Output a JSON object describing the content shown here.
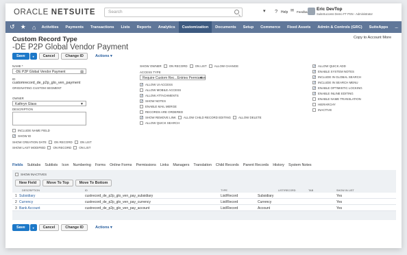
{
  "brand": {
    "oracle": "ORACLE",
    "netsuite": "NETSUITE"
  },
  "search": {
    "placeholder": "Search"
  },
  "header": {
    "help": "Help",
    "feedback": "Feedback",
    "user_name": "Eric DevTop",
    "user_sub": "SuiteSuccess Demo FT PSN - Administrator"
  },
  "nav": {
    "items": [
      "Activities",
      "Payments",
      "Transactions",
      "Lists",
      "Reports",
      "Analytics",
      "Customization",
      "Documents",
      "Setup",
      "Commerce",
      "Fixed Assets",
      "Admin & Controls (GRC)",
      "SuiteApps",
      "..."
    ],
    "active_index": 6
  },
  "page": {
    "title": "Custom Record Type",
    "record_name": "-DE P2P Global Vendor Payment",
    "copy_to_account": "Copy to Account",
    "more": "More"
  },
  "buttons": {
    "save": "Save",
    "cancel": "Cancel",
    "change_id": "Change ID",
    "actions": "Actions ▾"
  },
  "left": {
    "name_label": "NAME *",
    "name_value": "-DE P2P Global Vendor Payment",
    "id_label": "ID",
    "id_value": "customrecord_de_p2p_glo_ven_payment",
    "originating_label": "ORIGINATING CUSTOM SEGMENT",
    "owner_label": "OWNER",
    "owner_value": "Kathryn Glass",
    "description_label": "DESCRIPTION",
    "include_name": "INCLUDE NAME FIELD",
    "show_id": "SHOW ID",
    "show_creation": "SHOW CREATION DATE",
    "show_modified": "SHOW LAST MODIFIED",
    "on_record": "ON RECORD",
    "on_list": "ON LIST"
  },
  "mid": {
    "show_owner": "SHOW OWNER",
    "on_record": "ON RECORD",
    "on_list": "ON LIST",
    "allow_change": "ALLOW CHANGE",
    "access_label": "ACCESS TYPE",
    "access_value": "Require Custom Rec...Entries Permission",
    "checks": [
      {
        "label": "ALLOW UI ACCESS",
        "checked": true
      },
      {
        "label": "ALLOW MOBILE ACCESS",
        "checked": false
      },
      {
        "label": "ALLOW ATTACHMENTS",
        "checked": true
      },
      {
        "label": "SHOW NOTES",
        "checked": true
      },
      {
        "label": "ENABLE MAIL MERGE",
        "checked": false
      },
      {
        "label": "RECORDS ARE ORDERED",
        "checked": false
      }
    ],
    "show_remove": "SHOW REMOVE LINK",
    "child_edit": "ALLOW CHILD RECORD EDITING",
    "allow_delete": "ALLOW DELETE",
    "quick_search": "ALLOW QUICK SEARCH"
  },
  "right": {
    "checks": [
      {
        "label": "ALLOW QUICK ADD",
        "checked": true
      },
      {
        "label": "ENABLE SYSTEM NOTES",
        "checked": true
      },
      {
        "label": "INCLUDE IN GLOBAL SEARCH",
        "checked": true
      },
      {
        "label": "INCLUDE IN SEARCH MENU",
        "checked": true
      },
      {
        "label": "ENABLE OPTIMISTIC LOCKING",
        "checked": true
      },
      {
        "label": "ENABLE INLINE EDITING",
        "checked": true
      },
      {
        "label": "ENABLE NAME TRANSLATION",
        "checked": false
      },
      {
        "label": "HIERARCHY",
        "checked": false
      },
      {
        "label": "INACTIVE",
        "checked": false
      }
    ]
  },
  "tabs": [
    "Fields",
    "Subtabs",
    "Sublists",
    "Icon",
    "Numbering",
    "Forms",
    "Online Forms",
    "Permissions",
    "Links",
    "Managers",
    "Translation",
    "Child Records",
    "Parent Records",
    "History",
    "System Notes"
  ],
  "sublist": {
    "show_inactives": "SHOW INACTIVES",
    "new_field": "New Field",
    "move_top": "Move To Top",
    "move_bottom": "Move To Bottom",
    "headers": [
      "DESCRIPTION",
      "ID",
      "TYPE",
      "LIST/RECORD",
      "TAB",
      "SHOW IN LIST"
    ],
    "rows": [
      {
        "num": "1",
        "desc": "Subsidiary",
        "id": "custrecord_de_p2p_glo_ven_pay_subsidiary",
        "type": "List/Record",
        "list": "Subsidiary",
        "tab": "",
        "show": "Yes"
      },
      {
        "num": "2",
        "desc": "Currency",
        "id": "custrecord_de_p2p_glo_ven_pay_currency",
        "type": "List/Record",
        "list": "Currency",
        "tab": "",
        "show": "Yes"
      },
      {
        "num": "3",
        "desc": "Bank Account",
        "id": "custrecord_de_p2p_glo_ven_pay_account",
        "type": "List/Record",
        "list": "Account",
        "tab": "",
        "show": "Yes"
      }
    ]
  },
  "colors": {
    "nav": "#607799",
    "nav_active": "#3d5a80",
    "primary": "#1c78c8",
    "link": "#245b9c"
  }
}
